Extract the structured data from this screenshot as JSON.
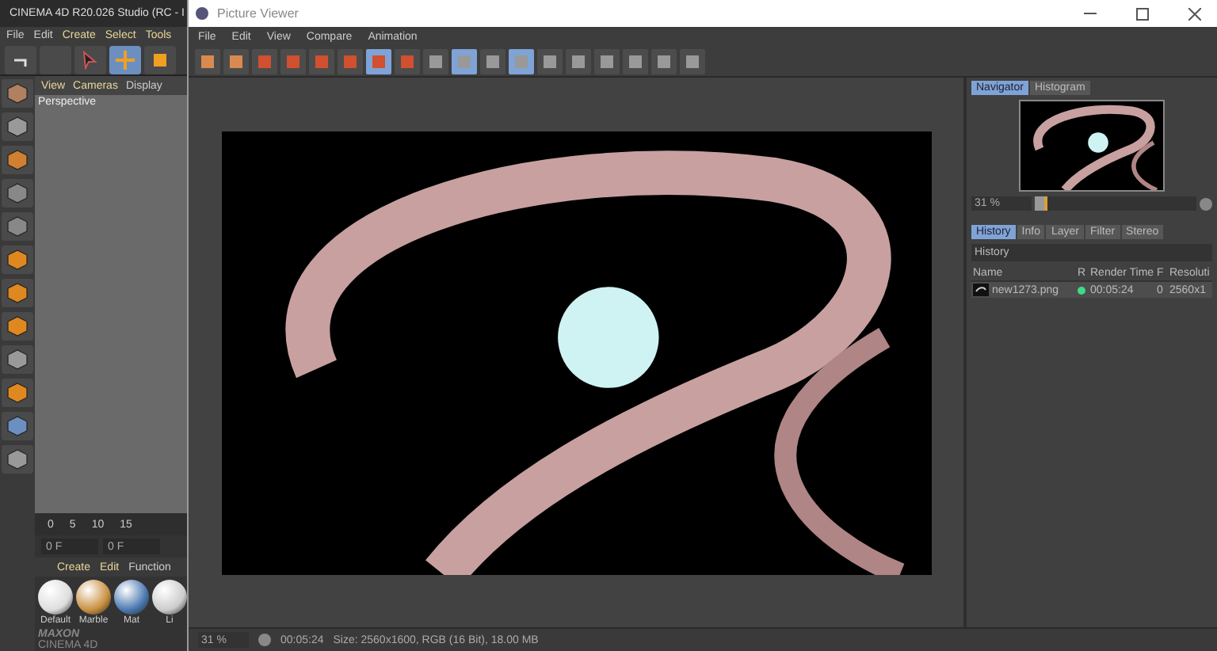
{
  "background_app": {
    "title": "CINEMA 4D R20.026 Studio (RC - I",
    "menu": [
      "File",
      "Edit",
      "Create",
      "Select",
      "Tools"
    ],
    "viewport_tabs": [
      "View",
      "Cameras",
      "Display"
    ],
    "viewport_label": "Perspective",
    "timeline_ticks": [
      "0",
      "5",
      "10",
      "15"
    ],
    "frame_field": "0 F",
    "frame_field_2": "0 F",
    "material_menu": [
      "Create",
      "Edit",
      "Function"
    ],
    "materials": [
      "Default",
      "Marble",
      "Mat",
      "Li"
    ],
    "logo_top": "MAXON",
    "logo_bottom": "CINEMA 4D"
  },
  "window": {
    "title": "Picture Viewer"
  },
  "menu": [
    "File",
    "Edit",
    "View",
    "Compare",
    "Animation"
  ],
  "toolbar": [
    {
      "selected": false
    },
    {
      "selected": false
    },
    {
      "selected": false
    },
    {
      "selected": false
    },
    {
      "selected": false
    },
    {
      "selected": false
    },
    {
      "selected": true
    },
    {
      "selected": false
    },
    {
      "selected": false
    },
    {
      "selected": true
    },
    {
      "selected": false
    },
    {
      "selected": true
    },
    {
      "selected": false
    },
    {
      "selected": false
    },
    {
      "selected": false
    },
    {
      "selected": false
    },
    {
      "selected": false
    },
    {
      "selected": false
    }
  ],
  "navigator": {
    "tabs": [
      {
        "label": "Navigator",
        "selected": true
      },
      {
        "label": "Histogram",
        "selected": false
      }
    ],
    "zoom": "31 %",
    "level": 0.08
  },
  "history": {
    "tabs": [
      {
        "label": "History",
        "selected": true
      },
      {
        "label": "Info",
        "selected": false
      },
      {
        "label": "Layer",
        "selected": false
      },
      {
        "label": "Filter",
        "selected": false
      },
      {
        "label": "Stereo",
        "selected": false
      }
    ],
    "header": "History",
    "columns": [
      "Name",
      "R",
      "Render Time",
      "F",
      "Resoluti"
    ],
    "rows": [
      {
        "name": "new1273.png",
        "color": "#3ddc84",
        "render_time": "00:05:24",
        "f": "0",
        "resolution": "2560x1"
      }
    ]
  },
  "status_bar": {
    "zoom": "31 %",
    "time": "00:05:24",
    "info": "Size: 2560x1600, RGB (16 Bit), 18.00 MB"
  }
}
